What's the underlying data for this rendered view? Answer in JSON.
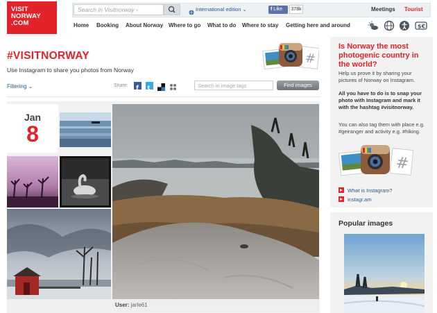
{
  "header": {
    "logo_line1": "VISIT",
    "logo_line2": "NORWAY",
    "logo_line3": ".COM",
    "search_placeholder": "Search in Visitnorway ›",
    "edition_label": "International edition ⌄",
    "fb_like_label": "Like",
    "fb_like_count": "378k",
    "links": [
      "Meetings",
      "Tourist"
    ],
    "nav": [
      "Home",
      "Booking",
      "About Norway",
      "Where to go",
      "What to do",
      "Where to stay",
      "Getting here and around"
    ],
    "icons": [
      "weather-icon",
      "globe-icon",
      "accessibility-icon",
      "currency-icon"
    ]
  },
  "page": {
    "title": "#VISITNORWAY",
    "subtitle": "Use Instagram to share you photos from Norway",
    "filter_label": "Filtering ⌄",
    "share_label": "Share:",
    "share_icons": [
      "facebook-icon",
      "twitter-icon",
      "delicious-icon",
      "share-more-icon"
    ],
    "tag_search_placeholder": "Search in image tags",
    "find_button": "Find images"
  },
  "grid": {
    "date_month": "Jan",
    "date_day": "8",
    "main_caption_label": "User:",
    "main_caption_user": "jarle61"
  },
  "sidebar": {
    "title": "Is Norway the most photogenic country in the world?",
    "paragraph1": "Help us prove it by sharing your pictures of Norway on Instagram.",
    "paragraph2": "All you have to do is to snap your photo with Instagram and mark it with the hashtag #visitnorway.",
    "paragraph3": "You can also tag them with place e.g. #geiranger and activity e.g. #hiking.",
    "links": [
      "What is Instagram?",
      "instagr.am"
    ],
    "popular_title": "Popular images"
  },
  "colors": {
    "brand_red": "#e2232a",
    "link_blue": "#2b5a8a"
  }
}
